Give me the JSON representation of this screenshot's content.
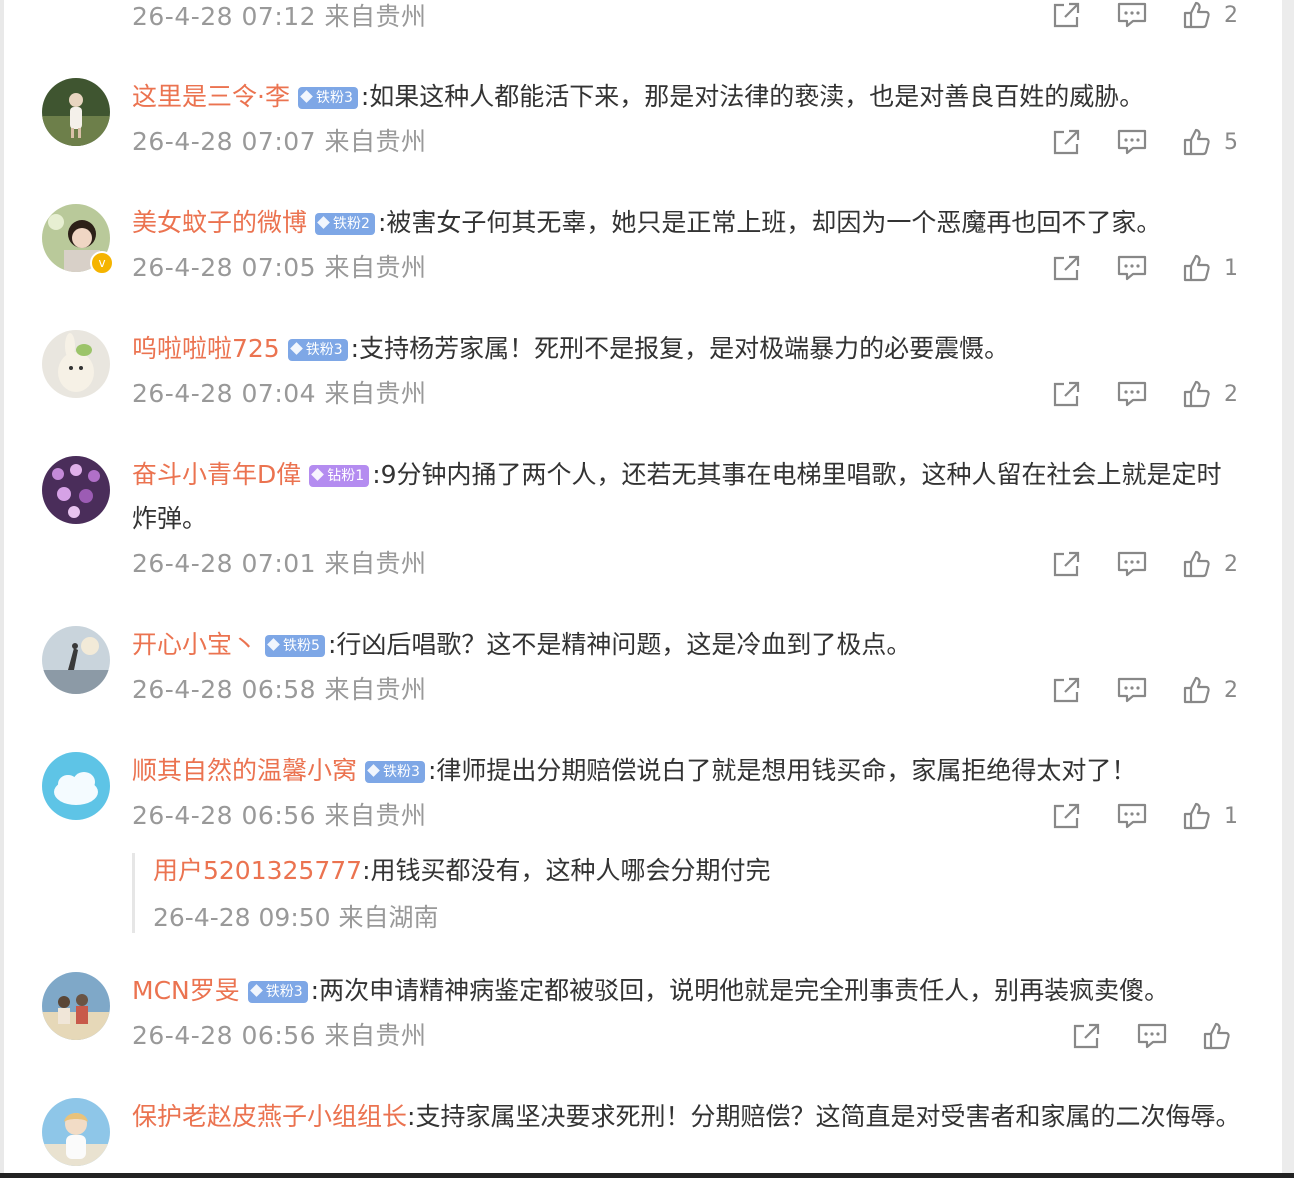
{
  "comments": [
    {
      "meta": "26-4-28 07:12 来自贵州",
      "likes": "2"
    },
    {
      "user": "这里是三令·李",
      "badge": "铁粉3",
      "text": ":如果这种人都能活下来，那是对法律的亵渎，也是对善良百姓的威胁。",
      "meta": "26-4-28 07:07 来自贵州",
      "likes": "5"
    },
    {
      "user": "美女蚊子的微博",
      "badge": "铁粉2",
      "text": ":被害女子何其无辜，她只是正常上班，却因为一个恶魔再也回不了家。",
      "meta": "26-4-28 07:05 来自贵州",
      "likes": "1"
    },
    {
      "user": "呜啦啦啦725",
      "badge": "铁粉3",
      "text": ":支持杨芳家属！死刑不是报复，是对极端暴力的必要震慑。",
      "meta": "26-4-28 07:04 来自贵州",
      "likes": "2"
    },
    {
      "user": "奋斗小青年D偉",
      "badge": "钻粉1",
      "text": ":9分钟内捅了两个人，还若无其事在电梯里唱歌，这种人留在社会上就是定时炸弹。",
      "meta": "26-4-28 07:01 来自贵州",
      "likes": "2"
    },
    {
      "user": "开心小宝丶",
      "badge": "铁粉5",
      "text": ":行凶后唱歌？这不是精神问题，这是冷血到了极点。",
      "meta": "26-4-28 06:58 来自贵州",
      "likes": "2"
    },
    {
      "user": "顺其自然的温馨小窝",
      "badge": "铁粉3",
      "text": ":律师提出分期赔偿说白了就是想用钱买命，家属拒绝得太对了！",
      "meta": "26-4-28 06:56 来自贵州",
      "likes": "1",
      "reply": {
        "user": "用户5201325777",
        "text": ":用钱买都没有，这种人哪会分期付完",
        "meta": "26-4-28 09:50 来自湖南"
      }
    },
    {
      "user": "MCN罗旻",
      "badge": "铁粉3",
      "text": ":两次申请精神病鉴定都被驳回，说明他就是完全刑事责任人，别再装疯卖傻。",
      "meta": "26-4-28 06:56 来自贵州"
    },
    {
      "user": "保护老赵皮燕子小组组长",
      "text": ":支持家属坚决要求死刑！分期赔偿？这简直是对受害者和家属的二次侮辱。"
    }
  ],
  "icons": {
    "share": "share-icon",
    "comment": "comment-icon",
    "like": "thumbs-up-icon",
    "verified": "verified-badge-icon"
  },
  "colors": {
    "username": "#eb7350",
    "iron_badge": "#7ea7e6",
    "diamond_badge": "#b48cf0",
    "meta": "#999999",
    "verified": "#f5b400"
  }
}
